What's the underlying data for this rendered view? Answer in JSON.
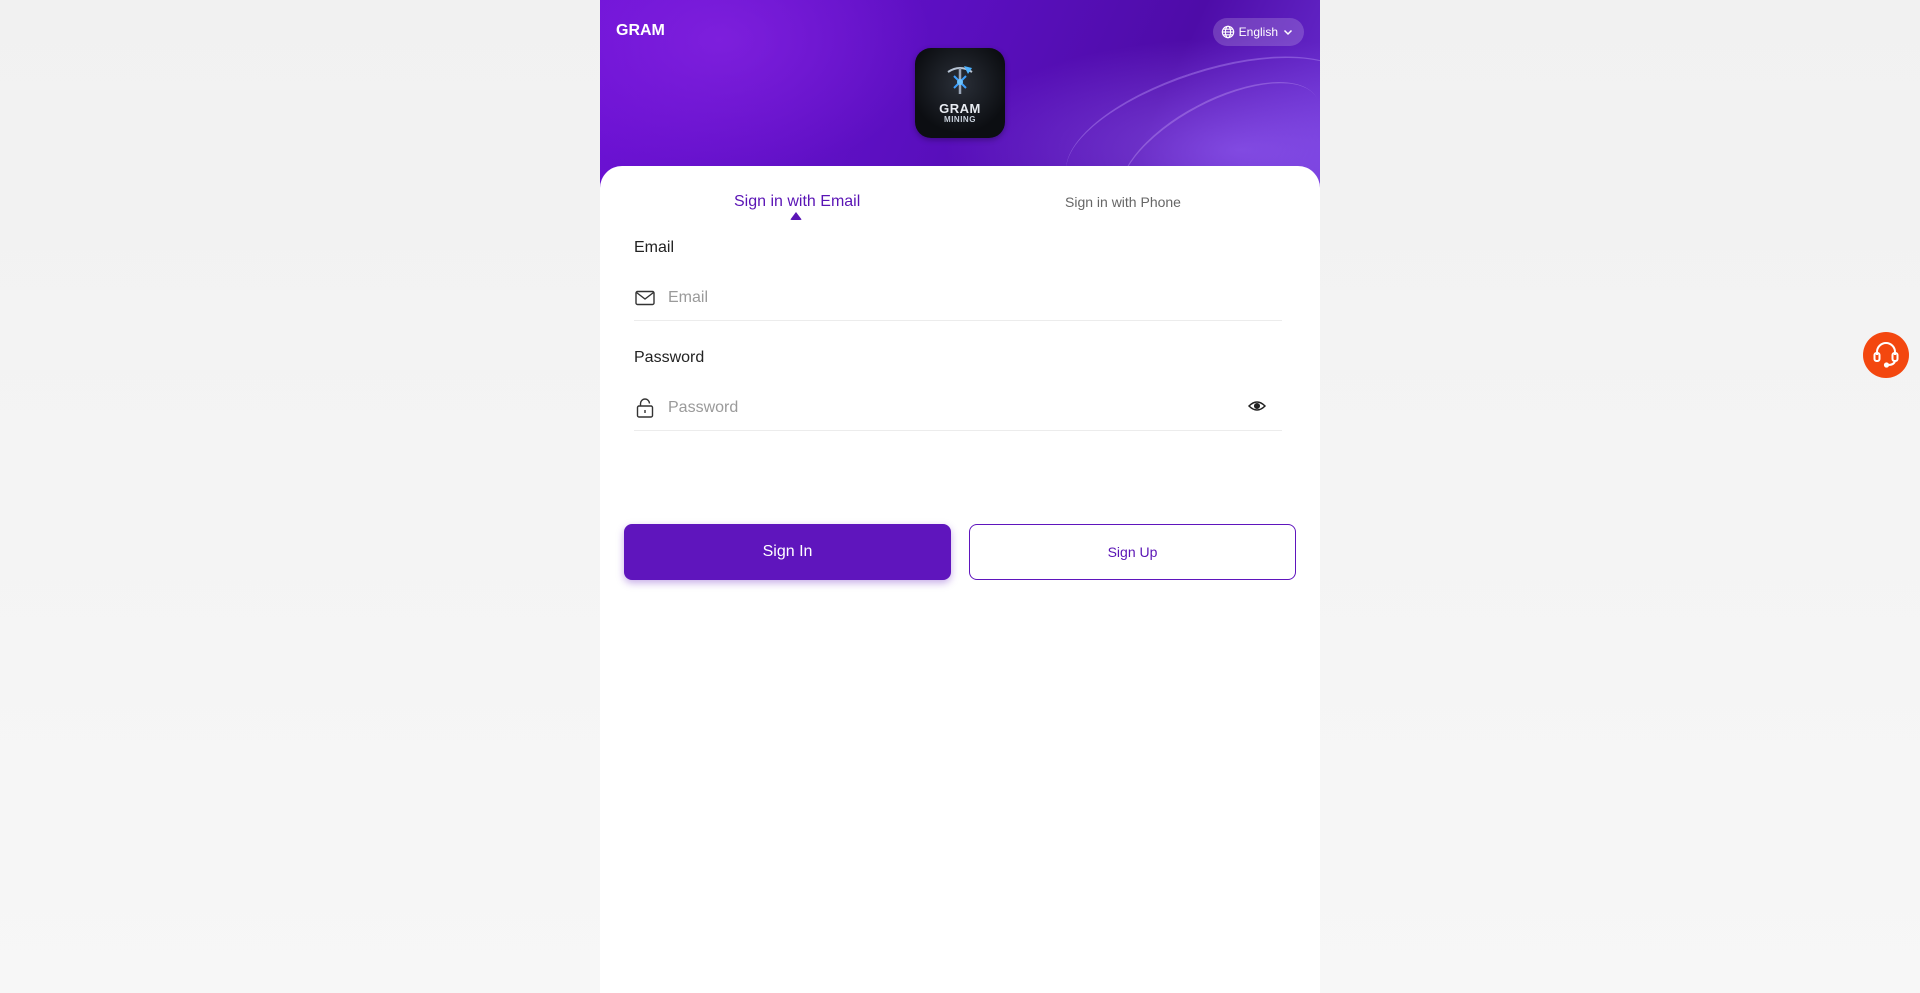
{
  "header": {
    "brand": "GRAM",
    "language": "English",
    "logo": {
      "line1": "GRAM",
      "line2": "MINING"
    }
  },
  "tabs": {
    "email": "Sign in with Email",
    "phone": "Sign in with Phone",
    "active": "email"
  },
  "form": {
    "email": {
      "label": "Email",
      "placeholder": "Email",
      "value": ""
    },
    "password": {
      "label": "Password",
      "placeholder": "Password",
      "value": ""
    }
  },
  "buttons": {
    "sign_in": "Sign In",
    "sign_up": "Sign Up"
  },
  "colors": {
    "accent": "#5f15bd",
    "support": "#f3470f"
  },
  "icons": {
    "language": "globe-icon",
    "dropdown": "chevron-down-icon",
    "email": "mail-icon",
    "password": "lock-icon",
    "toggle_password": "eye-icon",
    "support": "headset-icon"
  }
}
